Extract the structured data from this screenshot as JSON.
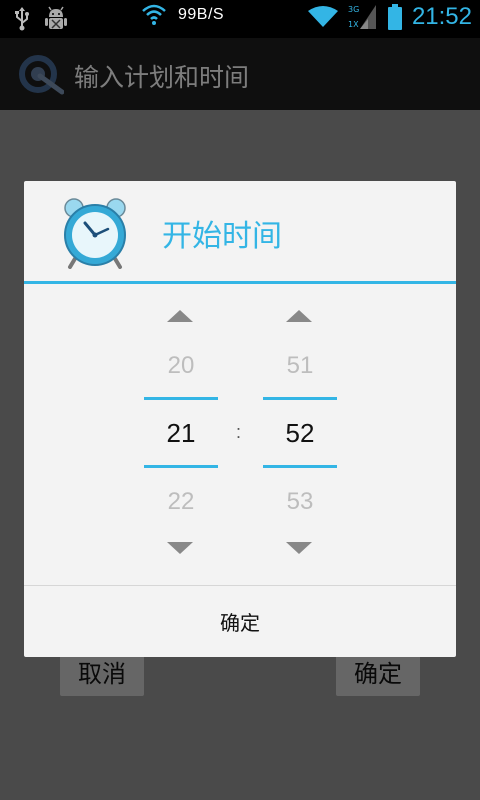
{
  "status_bar": {
    "icons_left": [
      "usb-icon",
      "android-debug-icon"
    ],
    "wifi_center_icon": "wifi-icon",
    "net_speed": "99B/S",
    "icons_right": [
      "wifi-icon",
      "signal-3g-1x-icon",
      "battery-icon"
    ],
    "time": "21:52",
    "accent": "#33b5e5"
  },
  "app": {
    "title": "输入计划和时间",
    "cancel_label": "取消",
    "confirm_label": "确定"
  },
  "dialog": {
    "title": "开始时间",
    "icon": "alarm-clock-icon",
    "hour": {
      "prev": "20",
      "current": "21",
      "next": "22"
    },
    "minute": {
      "prev": "51",
      "current": "52",
      "next": "53"
    },
    "separator": ":",
    "ok_label": "确定"
  }
}
